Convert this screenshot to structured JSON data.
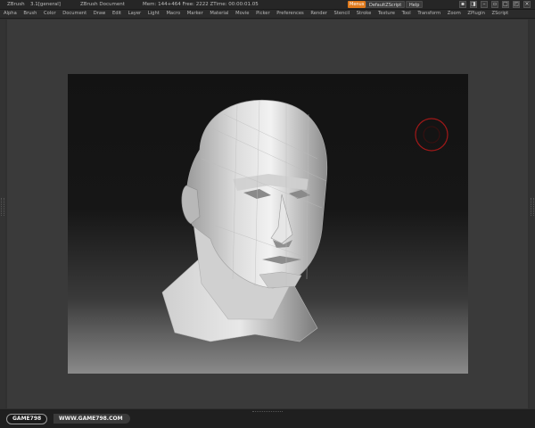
{
  "titlebar": {
    "app": "ZBrush",
    "version": "3.1[general]",
    "document": "ZBrush Document",
    "memory": "Mem: 144+464  Free: 2222  ZTime: 00:00:01.05",
    "menus_button": "Menus",
    "script_button": "DefaultZScript",
    "help_button": "Help"
  },
  "menubar": {
    "items": [
      "Alpha",
      "Brush",
      "Color",
      "Document",
      "Draw",
      "Edit",
      "Layer",
      "Light",
      "Macro",
      "Marker",
      "Material",
      "Movie",
      "Picker",
      "Preferences",
      "Render",
      "Stencil",
      "Stroke",
      "Texture",
      "Tool",
      "Transform",
      "Zoom",
      "ZPlugin",
      "ZScript"
    ]
  },
  "canvas": {
    "model": "low-poly male head sculpt",
    "cursor": "brush circle cursor",
    "accent_cursor_color": "#a01818",
    "bg_top": "#131313",
    "bg_bottom": "#8a8a8a"
  },
  "watermark": {
    "left": "GAME798",
    "right": "WWW.GAME798.COM"
  },
  "colors": {
    "menus_button": "#e07a1c",
    "chrome": "#303030"
  }
}
